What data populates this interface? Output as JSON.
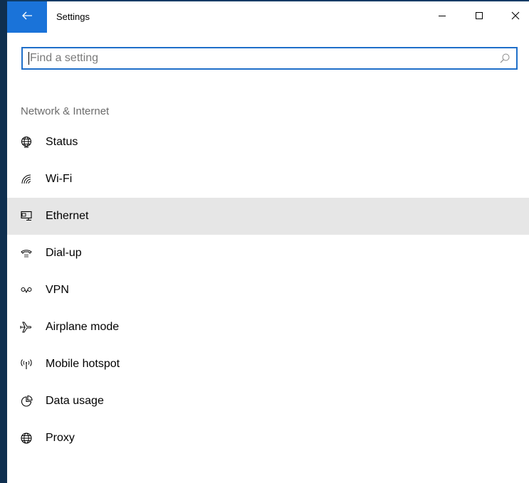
{
  "window": {
    "title": "Settings",
    "accent": "#1a73d9"
  },
  "titlebar": {
    "back_icon": "back-arrow-icon",
    "controls": [
      "minimize-icon",
      "maximize-icon",
      "close-icon"
    ]
  },
  "search": {
    "placeholder": "Find a setting",
    "value": "",
    "icon": "search-icon"
  },
  "sidebar": {
    "section_title": "Network & Internet",
    "selected_index": 2,
    "items": [
      {
        "label": "Status",
        "icon": "globe-status-icon"
      },
      {
        "label": "Wi-Fi",
        "icon": "wifi-icon"
      },
      {
        "label": "Ethernet",
        "icon": "ethernet-icon"
      },
      {
        "label": "Dial-up",
        "icon": "dialup-icon"
      },
      {
        "label": "VPN",
        "icon": "vpn-icon"
      },
      {
        "label": "Airplane mode",
        "icon": "airplane-icon"
      },
      {
        "label": "Mobile hotspot",
        "icon": "hotspot-icon"
      },
      {
        "label": "Data usage",
        "icon": "data-usage-icon"
      },
      {
        "label": "Proxy",
        "icon": "globe-icon"
      }
    ]
  }
}
